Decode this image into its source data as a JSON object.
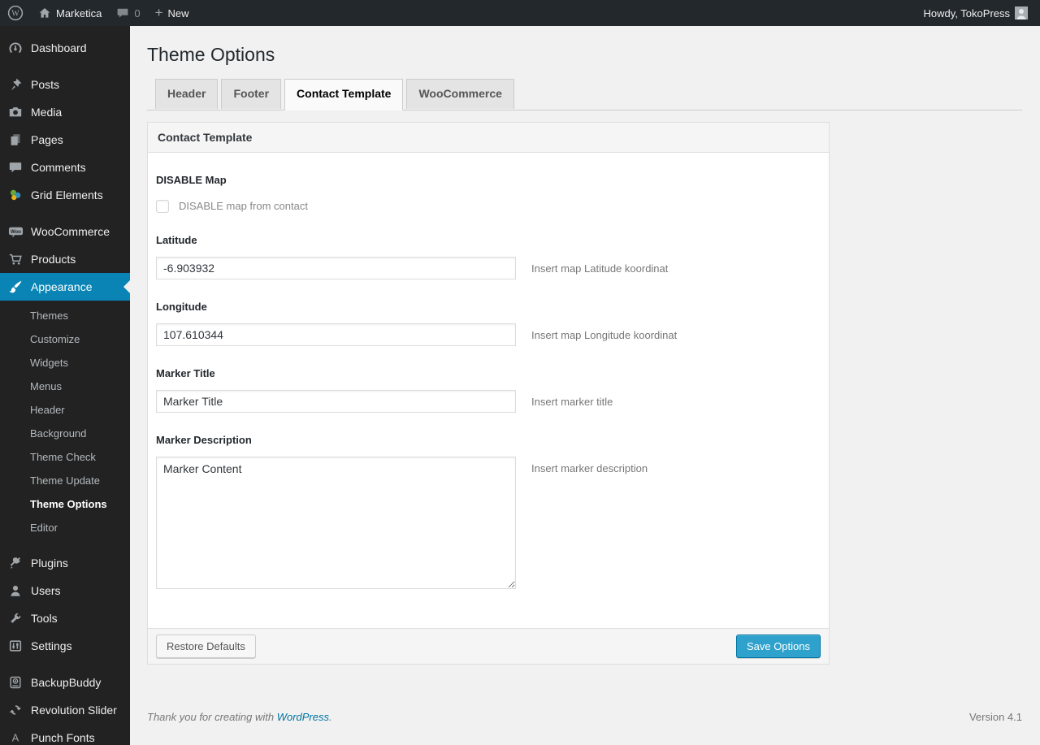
{
  "admin_bar": {
    "wordpress_logo_icon": "wordpress-logo-icon",
    "site_name": "Marketica",
    "site_icon": "home-icon",
    "comments_icon": "comment-bubble-icon",
    "comments_count": "0",
    "new_icon": "plus-icon",
    "new_label": "New",
    "howdy": "Howdy, TokoPress",
    "avatar_icon": "user-avatar"
  },
  "sidebar": {
    "items": [
      {
        "label": "Dashboard",
        "icon": "dashboard-icon"
      },
      {
        "label": "Posts",
        "icon": "pushpin-icon"
      },
      {
        "label": "Media",
        "icon": "media-camera-icon"
      },
      {
        "label": "Pages",
        "icon": "pages-icon"
      },
      {
        "label": "Comments",
        "icon": "comments-icon"
      },
      {
        "label": "Grid Elements",
        "icon": "grid-elements-icon"
      },
      {
        "label": "WooCommerce",
        "icon": "woocommerce-icon"
      },
      {
        "label": "Products",
        "icon": "cart-icon"
      },
      {
        "label": "Appearance",
        "icon": "paintbrush-icon",
        "active": true
      },
      {
        "label": "Plugins",
        "icon": "plugin-icon"
      },
      {
        "label": "Users",
        "icon": "users-icon"
      },
      {
        "label": "Tools",
        "icon": "wrench-icon"
      },
      {
        "label": "Settings",
        "icon": "settings-sliders-icon"
      },
      {
        "label": "BackupBuddy",
        "icon": "backup-drive-icon"
      },
      {
        "label": "Revolution Slider",
        "icon": "cycle-arrows-icon"
      },
      {
        "label": "Punch Fonts",
        "icon": "letter-a-icon"
      }
    ],
    "appearance_submenu": [
      "Themes",
      "Customize",
      "Widgets",
      "Menus",
      "Header",
      "Background",
      "Theme Check",
      "Theme Update",
      "Theme Options",
      "Editor"
    ],
    "current_submenu_item": "Theme Options"
  },
  "main": {
    "page_title": "Theme Options",
    "tabs": [
      {
        "label": "Header",
        "active": false
      },
      {
        "label": "Footer",
        "active": false
      },
      {
        "label": "Contact Template",
        "active": true
      },
      {
        "label": "WooCommerce",
        "active": false
      }
    ],
    "panel": {
      "title": "Contact Template",
      "fields": {
        "disable_map": {
          "label": "DISABLE Map",
          "checkbox_label": "DISABLE map from contact",
          "checked": false
        },
        "latitude": {
          "label": "Latitude",
          "value": "-6.903932",
          "description": "Insert map Latitude koordinat"
        },
        "longitude": {
          "label": "Longitude",
          "value": "107.610344",
          "description": "Insert map Longitude koordinat"
        },
        "marker_title": {
          "label": "Marker Title",
          "value": "Marker Title",
          "description": "Insert marker title"
        },
        "marker_description": {
          "label": "Marker Description",
          "value": "Marker Content",
          "description": "Insert marker description"
        }
      },
      "buttons": {
        "restore": "Restore Defaults",
        "save": "Save Options"
      }
    },
    "footer": {
      "thanks_prefix": "Thank you for creating with ",
      "link": "WordPress",
      "suffix": ".",
      "version": "Version 4.1"
    }
  },
  "colors": {
    "admin_bar_bg": "#23282d",
    "sidebar_bg": "#222222",
    "menu_highlight": "#0a84b5",
    "button_primary": "#2ea2cc",
    "button_primary_border": "#0074a2",
    "link": "#0074a2",
    "page_bg": "#f1f1f1"
  }
}
